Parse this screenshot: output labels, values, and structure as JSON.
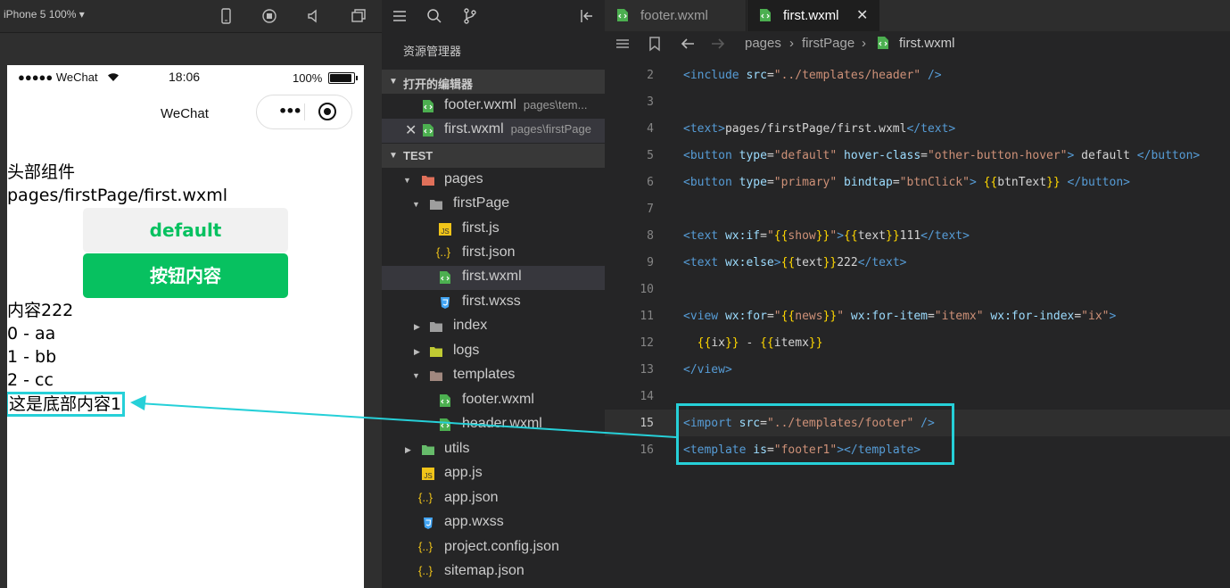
{
  "simulator": {
    "device_label": "iPhone 5 100% ▾",
    "status": {
      "carrier": "●●●●● WeChat",
      "time": "18:06",
      "battery": "100%"
    },
    "nav_title": "WeChat",
    "capsule_dots": "•••",
    "content": {
      "header_text": "头部组件",
      "path_text": "pages/firstPage/first.wxml",
      "default_button": "default",
      "primary_button": "按钮内容",
      "else_text": "内容222",
      "list": [
        "0 - aa",
        "1 - bb",
        "2 - cc"
      ],
      "footer_text": "这是底部内容1"
    }
  },
  "explorer": {
    "title": "资源管理器",
    "open_editors_header": "打开的编辑器",
    "open_editors": [
      {
        "name": "footer.wxml",
        "path": "pages\\tem..."
      },
      {
        "name": "first.wxml",
        "path": "pages\\firstPage"
      }
    ],
    "project_header": "TEST",
    "tree": {
      "pages": "pages",
      "firstPage": "firstPage",
      "first_js": "first.js",
      "first_json": "first.json",
      "first_wxml": "first.wxml",
      "first_wxss": "first.wxss",
      "index": "index",
      "logs": "logs",
      "templates": "templates",
      "footer_wxml": "footer.wxml",
      "header_wxml": "header.wxml",
      "utils": "utils",
      "app_js": "app.js",
      "app_json": "app.json",
      "app_wxss": "app.wxss",
      "project_config": "project.config.json",
      "sitemap": "sitemap.json"
    }
  },
  "editor": {
    "tabs": [
      {
        "label": "footer.wxml"
      },
      {
        "label": "first.wxml"
      }
    ],
    "breadcrumb": {
      "pages": "pages",
      "folder": "firstPage",
      "file": "first.wxml",
      "sep": "›"
    },
    "line_numbers": [
      "2",
      "3",
      "4",
      "5",
      "6",
      "7",
      "8",
      "9",
      "10",
      "11",
      "12",
      "13",
      "14",
      "15",
      "16"
    ]
  },
  "colors": {
    "accent": "#26d0d8",
    "wechat_green": "#07c160"
  }
}
